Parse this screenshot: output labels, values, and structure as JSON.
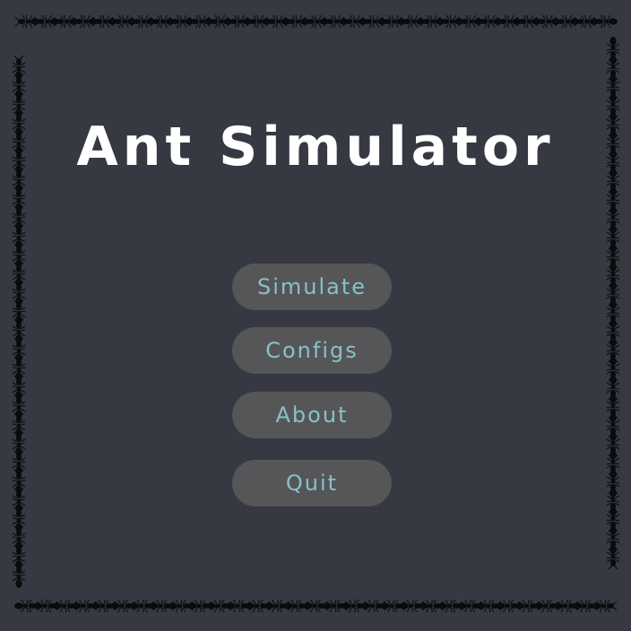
{
  "title": "Ant Simulator",
  "menu": {
    "simulate": "Simulate",
    "configs": "Configs",
    "about": "About",
    "quit": "Quit"
  },
  "colors": {
    "background": "#363941",
    "title": "#ffffff",
    "button_bg": "#565658",
    "button_text": "#88c1c9",
    "ant": "#0b0b0d"
  },
  "decoration": "ant-icon"
}
